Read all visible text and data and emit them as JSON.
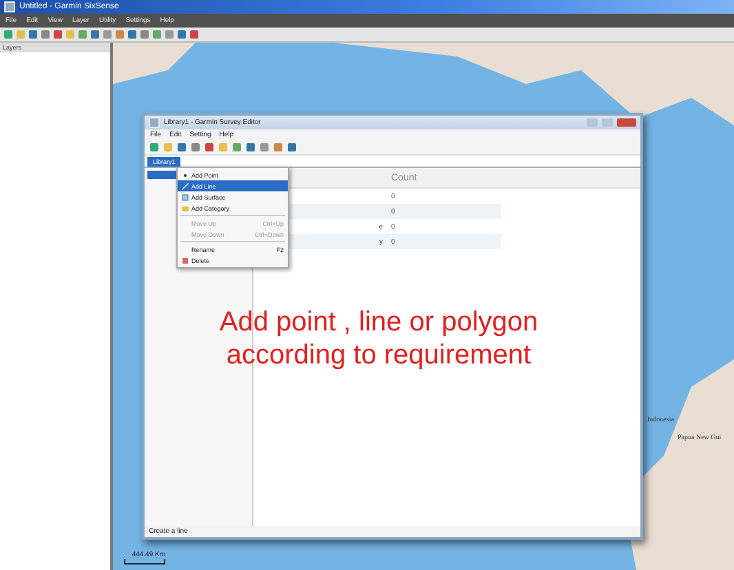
{
  "window": {
    "title": "Untitled - Garmin SixSense"
  },
  "menu": [
    "File",
    "Edit",
    "View",
    "Layer",
    "Utility",
    "Settings",
    "Help"
  ],
  "layers_panel": {
    "title": "Layers"
  },
  "map": {
    "labels": [
      "Indonesia",
      "Papua New Gui"
    ],
    "scale": "444.49 Km"
  },
  "editor": {
    "title": "Library1 - Garmin Survey Editor",
    "menu": [
      "File",
      "Edit",
      "Setting",
      "Help"
    ],
    "tabs": [
      {
        "label": "Library1",
        "selected": true
      }
    ],
    "table": {
      "columns": [
        "Count"
      ],
      "rows": [
        {
          "count": "0"
        },
        {
          "count": "0"
        },
        {
          "name": "e",
          "count": "0"
        },
        {
          "name": "y",
          "count": "0"
        }
      ]
    },
    "context_menu": [
      {
        "label": "Add Point",
        "kind": "point",
        "disabled": false,
        "selected": false
      },
      {
        "label": "Add Line",
        "kind": "line",
        "disabled": false,
        "selected": true
      },
      {
        "label": "Add Surface",
        "kind": "surface",
        "disabled": false,
        "selected": false
      },
      {
        "label": "Add Category",
        "kind": "category",
        "disabled": false,
        "selected": false
      },
      {
        "label": "Move Up",
        "shortcut": "Ctrl+Up",
        "kind": "separator-before",
        "disabled": true,
        "selected": false
      },
      {
        "label": "Move Down",
        "shortcut": "Ctrl+Down",
        "kind": "plain",
        "disabled": true,
        "selected": false
      },
      {
        "label": "Rename",
        "shortcut": "F2",
        "kind": "separator-before",
        "disabled": false,
        "selected": false
      },
      {
        "label": "Delete",
        "kind": "delete",
        "disabled": false,
        "selected": false
      }
    ],
    "status": "Create a line"
  },
  "annotation": [
    "Add point , line or polygon",
    "according  to requirement"
  ]
}
